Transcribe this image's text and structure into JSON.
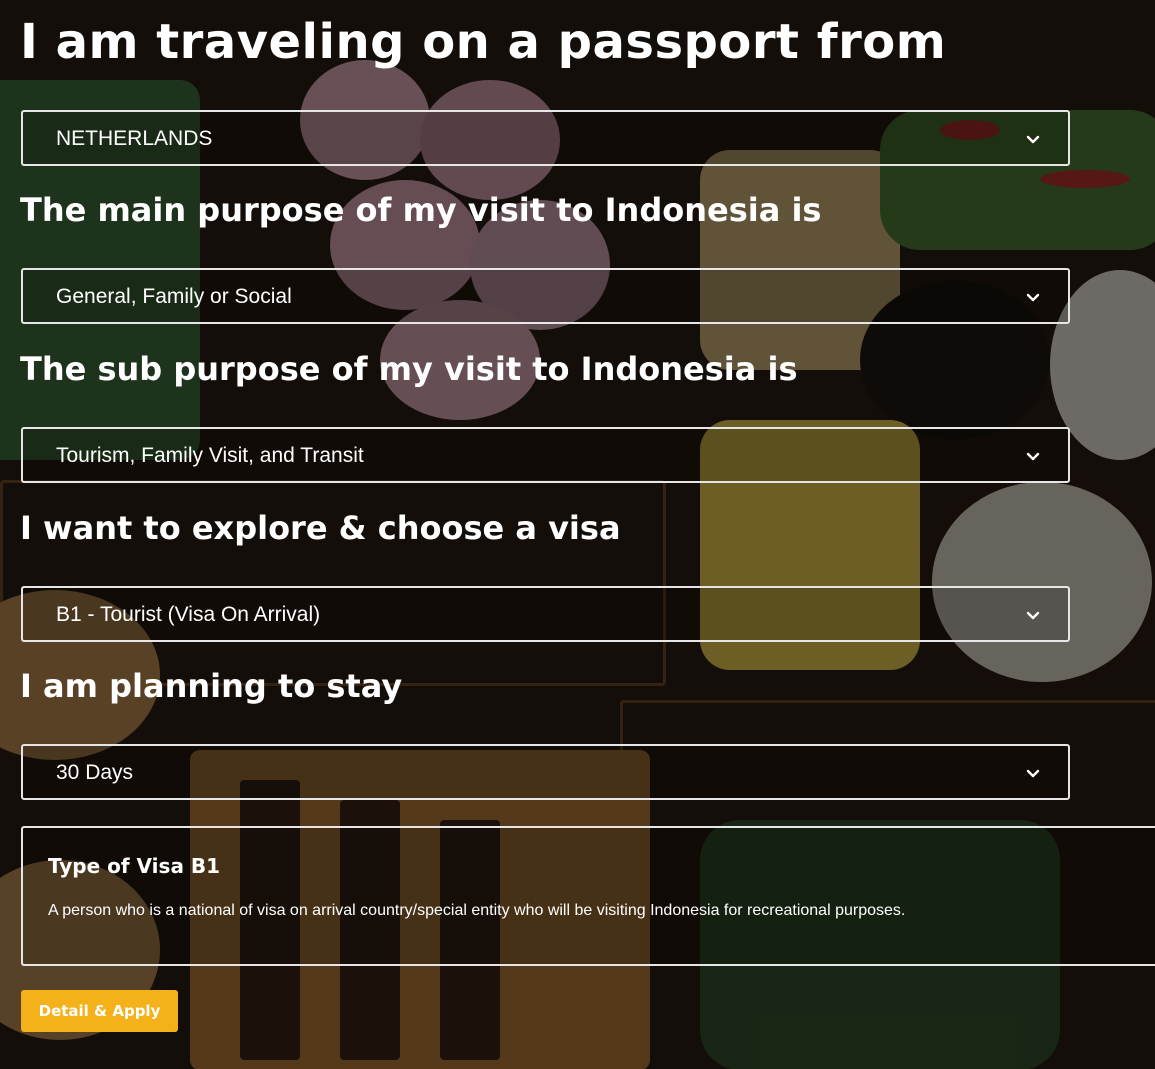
{
  "form": {
    "passport_heading": "I am traveling on a passport from",
    "passport_value": "NETHERLANDS",
    "purpose_heading": "The main purpose of my visit to Indonesia is",
    "purpose_value": "General, Family or Social",
    "subpurpose_heading": "The sub purpose of my visit to Indonesia is",
    "subpurpose_value": "Tourism, Family Visit, and Transit",
    "visa_heading": "I want to explore & choose a visa",
    "visa_value": "B1 - Tourist (Visa On Arrival)",
    "stay_heading": "I am planning to stay",
    "stay_value": "30 Days"
  },
  "visa_info": {
    "title": "Type of Visa B1",
    "description": "A person who is a national of visa on arrival country/special entity who will be visiting Indonesia for recreational purposes."
  },
  "apply_button": {
    "label": "Detail & Apply"
  },
  "icons": {
    "dropdown": "chevron-down-icon"
  },
  "colors": {
    "accent": "#f5b11a",
    "border": "#e6e6e6"
  }
}
